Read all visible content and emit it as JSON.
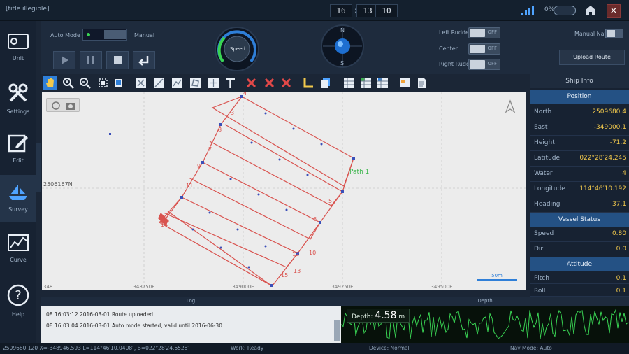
{
  "window": {
    "title": "[title illegible]",
    "clock": {
      "h": "16",
      "m": "13",
      "s": "10"
    },
    "battery": "0%",
    "close_glyph": "×"
  },
  "sidebar": {
    "items": [
      {
        "label": "Unit",
        "icon": "chip-icon"
      },
      {
        "label": "Settings",
        "icon": "tools-icon"
      },
      {
        "label": "Edit",
        "icon": "edit-icon"
      },
      {
        "label": "Survey",
        "icon": "boat-icon",
        "active": true
      },
      {
        "label": "Curve",
        "icon": "curve-chart-icon"
      },
      {
        "label": "Help",
        "icon": "help-icon"
      }
    ]
  },
  "control": {
    "mode_label": "Auto Mode",
    "mode_right_label": "Manual",
    "speed_label": "Speed",
    "compass_n": "N",
    "compass_s": "S",
    "toggles": [
      {
        "label": "Left Rudder",
        "state": "OFF"
      },
      {
        "label": "Center",
        "state": "OFF"
      },
      {
        "label": "Right Rudder",
        "state": "OFF"
      }
    ],
    "manual_label": "Manual Nav",
    "upload_label": "Upload Route"
  },
  "map": {
    "coord_left": "2506167N",
    "axis_bottom": [
      "348",
      "348750E",
      "349000E",
      "349250E",
      "349500E"
    ],
    "path_label": "Path 1",
    "waypoint_labels": [
      "3",
      "4",
      "5",
      "6",
      "7",
      "8",
      "9",
      "10",
      "11",
      "12",
      "13",
      "14",
      "15"
    ],
    "scale_label": "50m"
  },
  "info": {
    "header": "Ship Info",
    "section1": "Position",
    "rows1": [
      {
        "k": "North",
        "v": "2509680.4"
      },
      {
        "k": "East",
        "v": "-349000.1"
      },
      {
        "k": "Height",
        "v": "-71.2"
      },
      {
        "k": "Latitude",
        "v": "022°28′24.245"
      },
      {
        "k": "Water",
        "v": "4"
      },
      {
        "k": "Longitude",
        "v": "114°46′10.192"
      },
      {
        "k": "Heading",
        "v": "37.1"
      }
    ],
    "section2": "Vessel Status",
    "rows2": [
      {
        "k": "Speed",
        "v": "0.80"
      },
      {
        "k": "Dir",
        "v": "0.0"
      }
    ],
    "section3": "Attitude",
    "rows3": [
      {
        "k": "Pitch",
        "v": "0.1"
      },
      {
        "k": "Roll",
        "v": "0.1"
      }
    ]
  },
  "log": {
    "header": "Log",
    "lines": [
      "08 16:03:12 2016-03-01  Route uploaded",
      "08 16:03:04 2016-03-01  Auto mode started, valid until 2016-06-30"
    ]
  },
  "depth": {
    "header": "Depth",
    "label": "Depth:",
    "value": "4.58",
    "unit": "m"
  },
  "status": {
    "coords": "2509680.120 X=-348946.593  L=114°46′10.0408″, B=022°28′24.6528″",
    "work_state": "Work: Ready",
    "device_state": "Device: Normal",
    "nav_mode": "Nav Mode: Auto"
  },
  "colors": {
    "accent": "#2f7fd8",
    "route": "#d9534f",
    "path_label": "#39b54a",
    "depth_trace": "#39d353",
    "value": "#f2c94c"
  }
}
